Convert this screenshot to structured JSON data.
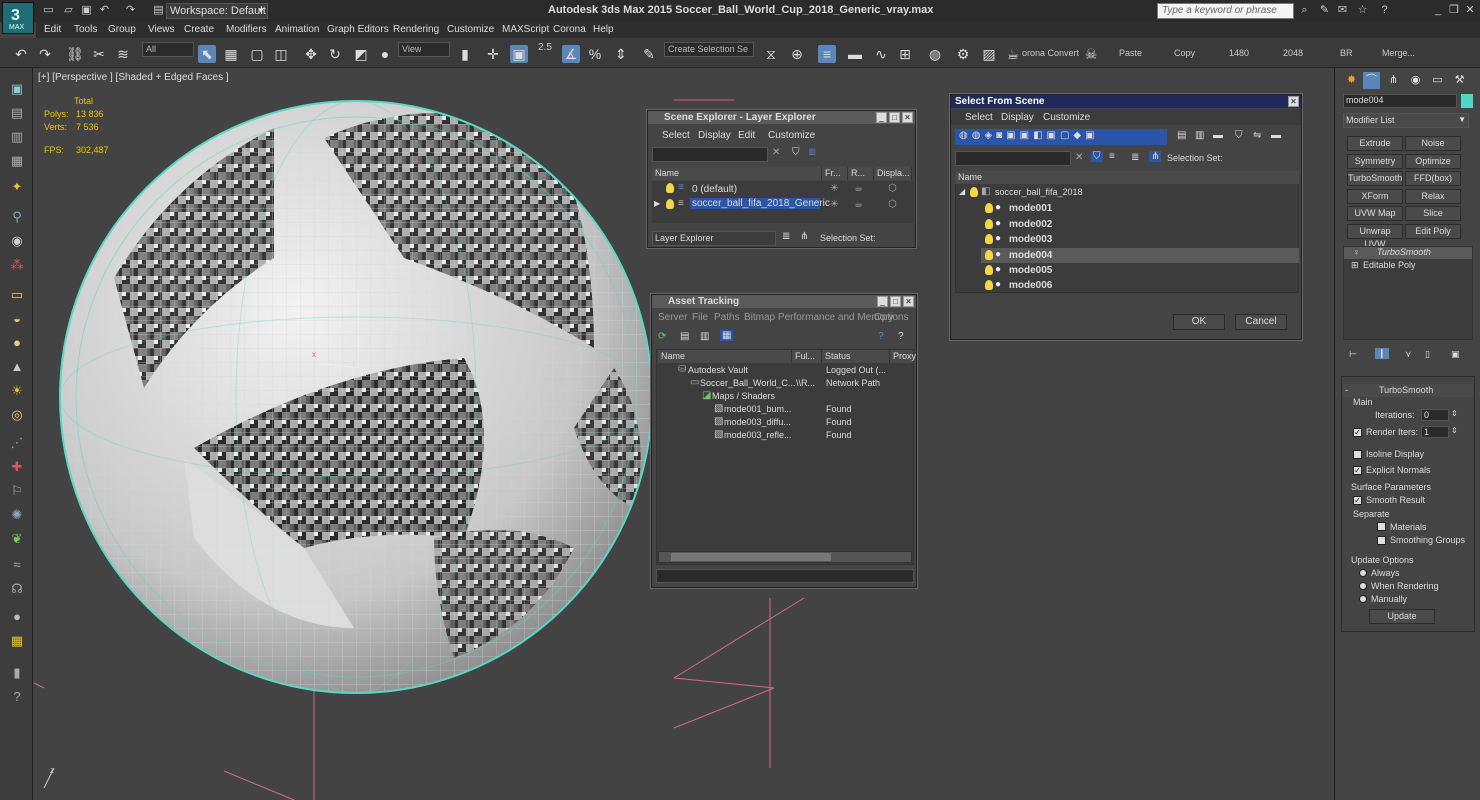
{
  "app": {
    "title": "Autodesk 3ds Max  2015     Soccer_Ball_World_Cup_2018_Generic_vray.max",
    "logo_label": "MAX",
    "workspace": "Workspace: Default",
    "search_placeholder": "Type a keyword or phrase"
  },
  "menu": [
    "Edit",
    "Tools",
    "Group",
    "Views",
    "Create",
    "Modifiers",
    "Animation",
    "Graph Editors",
    "Rendering",
    "Customize",
    "MAXScript",
    "Corona",
    "Help"
  ],
  "toolbar": {
    "filter": "All",
    "refcoord": "View",
    "snap_value": "2.5",
    "selection_set": "Create Selection Se",
    "corona_convert": "orona Convert",
    "paste": "Paste",
    "copy": "Copy",
    "v1480": "1480",
    "v2048": "2048",
    "br": "BR",
    "merge": "Merge..."
  },
  "viewport": {
    "label": "[+] [Perspective ] [Shaded + Edged Faces ]",
    "stats_total": "Total",
    "polys_label": "Polys:",
    "polys": "13 836",
    "verts_label": "Verts:",
    "verts": "7 536",
    "fps_label": "FPS:",
    "fps": "302,487",
    "axis_x": "x",
    "axis_z": "z",
    "axis_y": "y"
  },
  "scene_explorer": {
    "title": "Scene Explorer - Layer Explorer",
    "menu": [
      "Select",
      "Display",
      "Edit",
      "Customize"
    ],
    "headers": [
      "Name",
      "Fr...",
      "R...",
      "Displa..."
    ],
    "rows": [
      "0 (default)",
      "soccer_ball_fifa_2018_Generic"
    ],
    "footer_combo": "Layer Explorer",
    "selection_set_label": "Selection Set:"
  },
  "asset_tracking": {
    "title": "Asset Tracking",
    "menu": [
      "Server",
      "File",
      "Paths",
      "Bitmap Performance and Memory",
      "Options"
    ],
    "headers": [
      "Name",
      "Ful...",
      "Status",
      "Proxy"
    ],
    "rows": [
      {
        "name": "Autodesk Vault",
        "full": "",
        "status": "Logged Out (..."
      },
      {
        "name": "Soccer_Ball_World_C...",
        "full": "\\\\R...",
        "status": "Network Path"
      },
      {
        "name": "Maps / Shaders",
        "full": "",
        "status": ""
      },
      {
        "name": "mode001_bum...",
        "full": "",
        "status": "Found"
      },
      {
        "name": "mode003_diffu...",
        "full": "",
        "status": "Found"
      },
      {
        "name": "mode003_refle...",
        "full": "",
        "status": "Found"
      }
    ]
  },
  "select_from_scene": {
    "title": "Select From Scene",
    "menu": [
      "Select",
      "Display",
      "Customize"
    ],
    "selection_set_label": "Selection Set:",
    "header": "Name",
    "root": "soccer_ball_fifa_2018",
    "items": [
      "mode001",
      "mode002",
      "mode003",
      "mode004",
      "mode005",
      "mode006"
    ],
    "selected_item": "mode004",
    "ok": "OK",
    "cancel": "Cancel"
  },
  "command_panel": {
    "object_name": "mode004",
    "object_color": "#4fd6c8",
    "modifier_list": "Modifier List",
    "buttons": [
      "Extrude",
      "Noise",
      "Symmetry",
      "Optimize",
      "TurboSmooth",
      "FFD(box)",
      "XForm",
      "Relax",
      "UVW Map",
      "Slice",
      "Unwrap UVW",
      "Edit Poly"
    ],
    "stack": [
      "TurboSmooth",
      "Editable Poly"
    ],
    "rollout_title": "TurboSmooth",
    "main_label": "Main",
    "iterations_label": "Iterations:",
    "iterations": "0",
    "render_iters_label": "Render Iters:",
    "render_iters": "1",
    "isoline": "Isoline Display",
    "explicit_normals": "Explicit Normals",
    "surface_params": "Surface Parameters",
    "smooth_result": "Smooth Result",
    "separate": "Separate",
    "materials": "Materials",
    "smoothing_groups": "Smoothing Groups",
    "update_options": "Update Options",
    "always": "Always",
    "when_rendering": "When Rendering",
    "manually": "Manually",
    "update": "Update"
  }
}
